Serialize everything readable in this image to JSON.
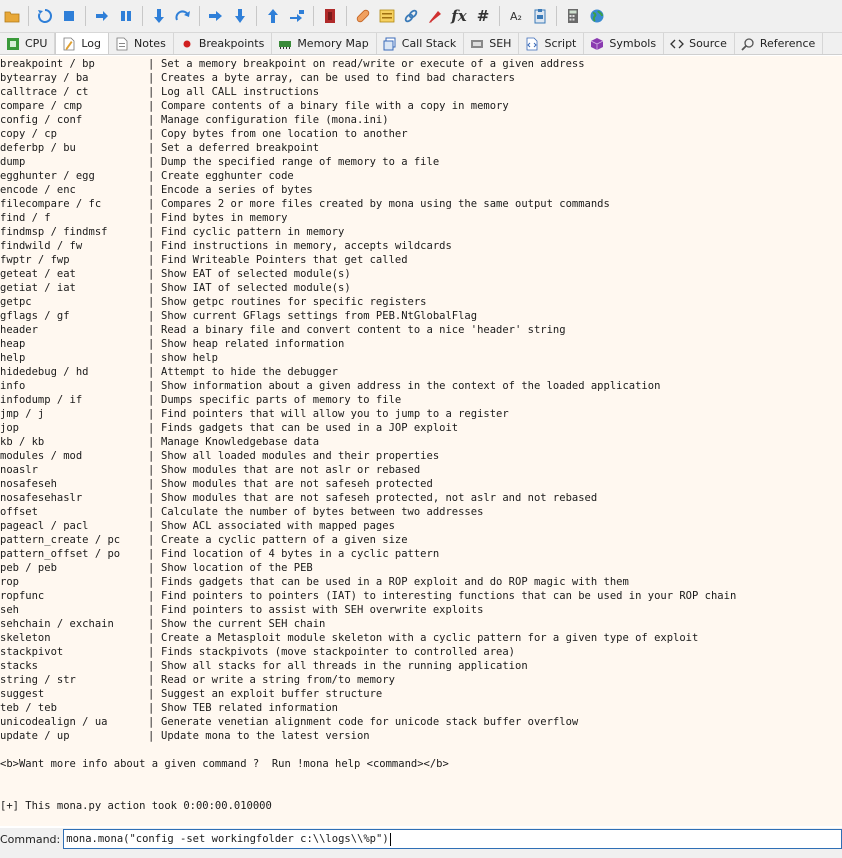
{
  "toolbar": {
    "buttons": [
      {
        "icon": "open-folder-icon",
        "color": "#e8a838"
      },
      {
        "icon": "restart-icon",
        "color": "#2f7fd8"
      },
      {
        "icon": "stop-icon",
        "color": "#2f7fd8"
      },
      {
        "icon": "run-icon",
        "color": "#2f7fd8"
      },
      {
        "icon": "pause-icon",
        "color": "#2f7fd8"
      },
      {
        "icon": "step-into-icon",
        "color": "#2f7fd8"
      },
      {
        "icon": "step-over-icon",
        "color": "#2f7fd8"
      },
      {
        "icon": "trace-into-icon",
        "color": "#2f7fd8"
      },
      {
        "icon": "trace-over-icon",
        "color": "#2f7fd8"
      },
      {
        "icon": "execute-till-return-icon",
        "color": "#2f7fd8"
      },
      {
        "icon": "run-to-user-code-icon",
        "color": "#2f7fd8"
      },
      {
        "icon": "scylla-icon",
        "color": "#b02a2a"
      },
      {
        "icon": "patch-icon",
        "color": "#e07a30"
      },
      {
        "icon": "comments-icon",
        "color": "#e0b020"
      },
      {
        "icon": "link-icon",
        "color": "#3a7ab8"
      },
      {
        "icon": "highlight-icon",
        "color": "#d03030"
      },
      {
        "icon": "function-icon",
        "label": "fx"
      },
      {
        "icon": "hash-icon",
        "label": "#"
      },
      {
        "icon": "font-size-icon",
        "label": "A₂"
      },
      {
        "icon": "clipboard-icon",
        "color": "#3a7ab8"
      },
      {
        "icon": "calculator-icon",
        "color": "#555555"
      },
      {
        "icon": "globe-icon",
        "color": "#2a8a3a"
      }
    ]
  },
  "tabs": [
    {
      "label": "CPU",
      "icon": "cpu-icon",
      "active": false
    },
    {
      "label": "Log",
      "icon": "log-icon",
      "active": true
    },
    {
      "label": "Notes",
      "icon": "notes-icon",
      "active": false
    },
    {
      "label": "Breakpoints",
      "icon": "breakpoint-icon",
      "active": false
    },
    {
      "label": "Memory Map",
      "icon": "memory-map-icon",
      "active": false
    },
    {
      "label": "Call Stack",
      "icon": "call-stack-icon",
      "active": false
    },
    {
      "label": "SEH",
      "icon": "seh-icon",
      "active": false
    },
    {
      "label": "Script",
      "icon": "script-icon",
      "active": false
    },
    {
      "label": "Symbols",
      "icon": "symbols-icon",
      "active": false
    },
    {
      "label": "Source",
      "icon": "source-icon",
      "active": false
    },
    {
      "label": "Reference",
      "icon": "reference-icon",
      "active": false
    }
  ],
  "log": {
    "separator": "|",
    "commands": [
      {
        "cmd": "breakpoint / bp",
        "desc": "Set a memory breakpoint on read/write or execute of a given address"
      },
      {
        "cmd": "bytearray / ba",
        "desc": "Creates a byte array, can be used to find bad characters"
      },
      {
        "cmd": "calltrace / ct",
        "desc": "Log all CALL instructions"
      },
      {
        "cmd": "compare / cmp",
        "desc": "Compare contents of a binary file with a copy in memory"
      },
      {
        "cmd": "config / conf",
        "desc": "Manage configuration file (mona.ini)"
      },
      {
        "cmd": "copy / cp",
        "desc": "Copy bytes from one location to another"
      },
      {
        "cmd": "deferbp / bu",
        "desc": "Set a deferred breakpoint"
      },
      {
        "cmd": "dump",
        "desc": "Dump the specified range of memory to a file"
      },
      {
        "cmd": "egghunter / egg",
        "desc": "Create egghunter code"
      },
      {
        "cmd": "encode / enc",
        "desc": "Encode a series of bytes"
      },
      {
        "cmd": "filecompare / fc",
        "desc": "Compares 2 or more files created by mona using the same output commands"
      },
      {
        "cmd": "find / f",
        "desc": "Find bytes in memory"
      },
      {
        "cmd": "findmsp / findmsf",
        "desc": "Find cyclic pattern in memory"
      },
      {
        "cmd": "findwild / fw",
        "desc": "Find instructions in memory, accepts wildcards"
      },
      {
        "cmd": "fwptr / fwp",
        "desc": "Find Writeable Pointers that get called"
      },
      {
        "cmd": "geteat / eat",
        "desc": "Show EAT of selected module(s)"
      },
      {
        "cmd": "getiat / iat",
        "desc": "Show IAT of selected module(s)"
      },
      {
        "cmd": "getpc",
        "desc": "Show getpc routines for specific registers"
      },
      {
        "cmd": "gflags / gf",
        "desc": "Show current GFlags settings from PEB.NtGlobalFlag"
      },
      {
        "cmd": "header",
        "desc": "Read a binary file and convert content to a nice 'header' string"
      },
      {
        "cmd": "heap",
        "desc": "Show heap related information"
      },
      {
        "cmd": "help",
        "desc": "show help"
      },
      {
        "cmd": "hidedebug / hd",
        "desc": "Attempt to hide the debugger"
      },
      {
        "cmd": "info",
        "desc": "Show information about a given address in the context of the loaded application"
      },
      {
        "cmd": "infodump / if",
        "desc": "Dumps specific parts of memory to file"
      },
      {
        "cmd": "jmp / j",
        "desc": "Find pointers that will allow you to jump to a register"
      },
      {
        "cmd": "jop",
        "desc": "Finds gadgets that can be used in a JOP exploit"
      },
      {
        "cmd": "kb / kb",
        "desc": "Manage Knowledgebase data"
      },
      {
        "cmd": "modules / mod",
        "desc": "Show all loaded modules and their properties"
      },
      {
        "cmd": "noaslr",
        "desc": "Show modules that are not aslr or rebased"
      },
      {
        "cmd": "nosafeseh",
        "desc": "Show modules that are not safeseh protected"
      },
      {
        "cmd": "nosafesehaslr",
        "desc": "Show modules that are not safeseh protected, not aslr and not rebased"
      },
      {
        "cmd": "offset",
        "desc": "Calculate the number of bytes between two addresses"
      },
      {
        "cmd": "pageacl / pacl",
        "desc": "Show ACL associated with mapped pages"
      },
      {
        "cmd": "pattern_create / pc",
        "desc": "Create a cyclic pattern of a given size"
      },
      {
        "cmd": "pattern_offset / po",
        "desc": "Find location of 4 bytes in a cyclic pattern"
      },
      {
        "cmd": "peb / peb",
        "desc": "Show location of the PEB"
      },
      {
        "cmd": "rop",
        "desc": "Finds gadgets that can be used in a ROP exploit and do ROP magic with them"
      },
      {
        "cmd": "ropfunc",
        "desc": "Find pointers to pointers (IAT) to interesting functions that can be used in your ROP chain"
      },
      {
        "cmd": "seh",
        "desc": "Find pointers to assist with SEH overwrite exploits"
      },
      {
        "cmd": "sehchain / exchain",
        "desc": "Show the current SEH chain"
      },
      {
        "cmd": "skeleton",
        "desc": "Create a Metasploit module skeleton with a cyclic pattern for a given type of exploit"
      },
      {
        "cmd": "stackpivot",
        "desc": "Finds stackpivots (move stackpointer to controlled area)"
      },
      {
        "cmd": "stacks",
        "desc": "Show all stacks for all threads in the running application"
      },
      {
        "cmd": "string / str",
        "desc": "Read or write a string from/to memory"
      },
      {
        "cmd": "suggest",
        "desc": "Suggest an exploit buffer structure"
      },
      {
        "cmd": "teb / teb",
        "desc": "Show TEB related information"
      },
      {
        "cmd": "unicodealign / ua",
        "desc": "Generate venetian alignment code for unicode stack buffer overflow"
      },
      {
        "cmd": "update / up",
        "desc": "Update mona to the latest version"
      }
    ],
    "more_info": "<b>Want more info about a given command ?  Run !mona help <command></b>",
    "timing": "[+] This mona.py action took 0:00:00.010000"
  },
  "command_bar": {
    "label": "Command:",
    "value": "mona.mona(\"config -set workingfolder c:\\\\logs\\\\%p\")"
  }
}
